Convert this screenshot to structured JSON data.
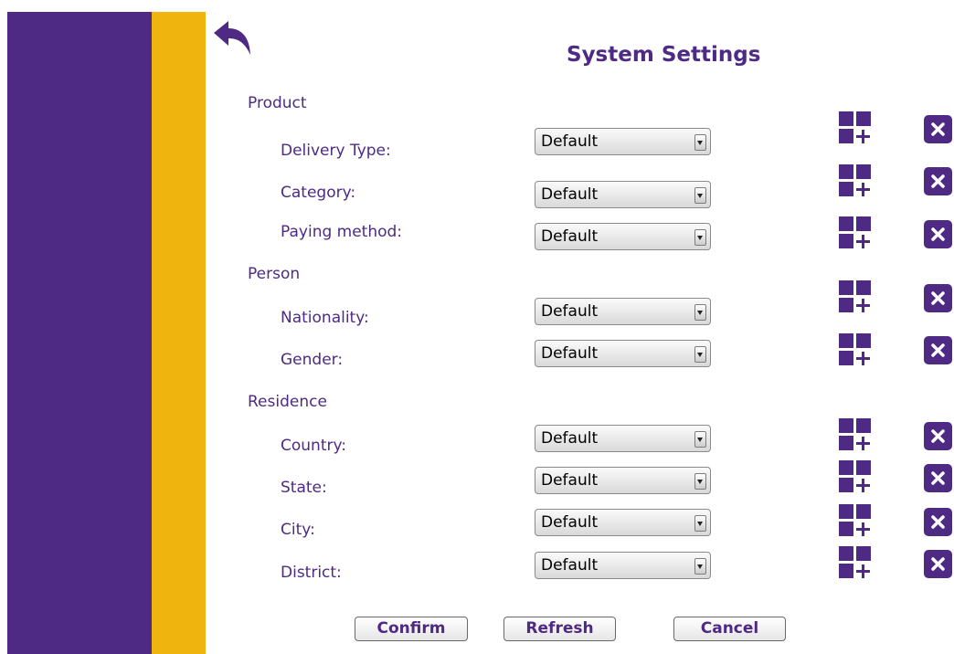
{
  "header": {
    "title": "System Settings"
  },
  "sections": [
    {
      "label": "Product",
      "fields": [
        {
          "label": "Delivery Type:",
          "value": "Default"
        },
        {
          "label": "Category:",
          "value": "Default"
        },
        {
          "label": "Paying method:",
          "value": "Default"
        }
      ]
    },
    {
      "label": "Person",
      "fields": [
        {
          "label": "Nationality:",
          "value": "Default"
        },
        {
          "label": "Gender:",
          "value": "Default"
        }
      ]
    },
    {
      "label": "Residence",
      "fields": [
        {
          "label": "Country:",
          "value": "Default"
        },
        {
          "label": "State:",
          "value": "Default"
        },
        {
          "label": "City:",
          "value": "Default"
        },
        {
          "label": "District:",
          "value": "Default"
        }
      ]
    }
  ],
  "buttons": {
    "confirm": "Confirm",
    "refresh": "Refresh",
    "cancel": "Cancel"
  },
  "icons": {
    "back": "back-arrow-icon",
    "add": "add-grid-icon",
    "delete": "close-icon"
  },
  "colors": {
    "primary": "#4e2a84",
    "accent": "#f0b40f"
  }
}
